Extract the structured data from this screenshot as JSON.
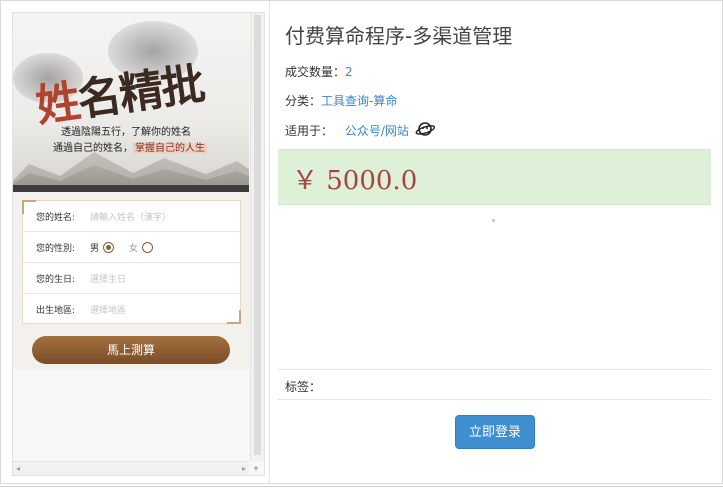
{
  "preview": {
    "banner_title": [
      "姓",
      "名",
      "精",
      "批"
    ],
    "banner_sub1": "透過陰陽五行，了解你的姓名",
    "banner_sub2a": "通過自己的姓名，",
    "banner_sub2b": "掌握自己的人生",
    "form": {
      "name_label": "您的姓名:",
      "name_placeholder": "請輸入姓名（漢字）",
      "gender_label": "您的性別:",
      "gender_male": "男",
      "gender_female": "女",
      "birthday_label": "您的生日:",
      "birthday_placeholder": "選擇生日",
      "region_label": "出生地區:",
      "region_placeholder": "選擇地區"
    },
    "submit_label": "馬上測算"
  },
  "product": {
    "title": "付费算命程序-多渠道管理",
    "deals_label": "成交数量：",
    "deals_value": "2",
    "category_label": "分类：",
    "category_value": "工具查询-算命",
    "applies_label": "适用于：",
    "applies_value": "公众号/网站",
    "price": "￥ 5000.0",
    "tags_label": "标签：",
    "login_label": "立即登录"
  },
  "colors": {
    "price_bg": "#dff0d8",
    "price_text": "#a94442",
    "link": "#3b85c7",
    "login_bg": "#3e8ed0",
    "submit_bg": "#8a5b3a"
  },
  "icons": {
    "applies_icon": "planet-icon"
  }
}
